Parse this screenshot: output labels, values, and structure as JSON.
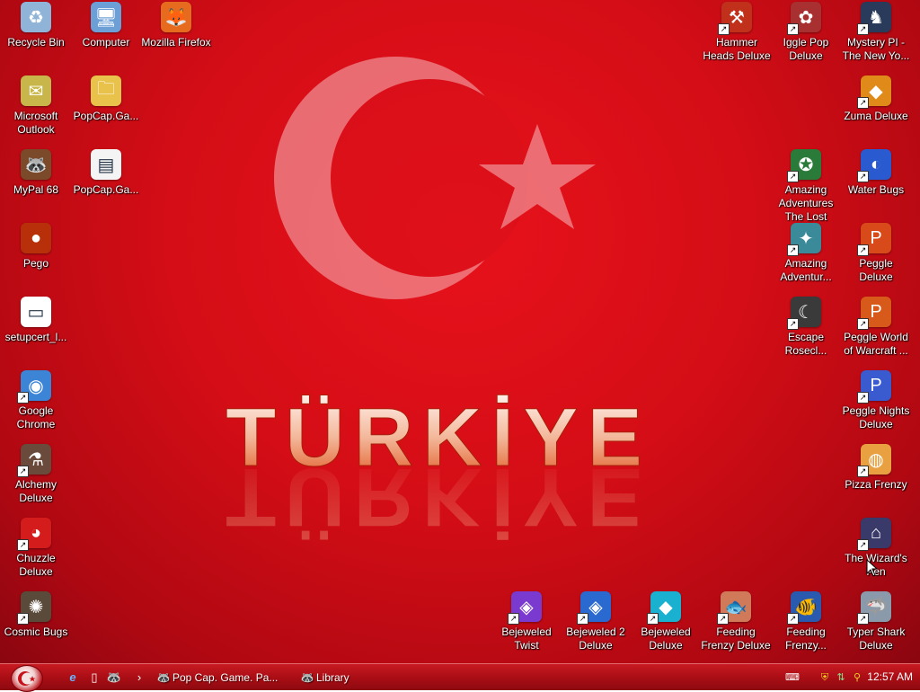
{
  "desktop": {
    "wallpaper_text": "TÜRKİYE",
    "icons": [
      {
        "id": "recycle-bin",
        "label": "Recycle Bin",
        "icon": "recycle-bin-icon",
        "color": "#8fb4d8",
        "glyph": "♻",
        "shortcut": false
      },
      {
        "id": "computer",
        "label": "Computer",
        "icon": "computer-icon",
        "color": "#6c9fd6",
        "glyph": "🖥",
        "shortcut": false
      },
      {
        "id": "mozilla-firefox",
        "label": "Mozilla Firefox",
        "icon": "firefox-icon",
        "color": "#e66b1f",
        "glyph": "🦊",
        "shortcut": false
      },
      {
        "id": "microsoft-outlook",
        "label": "Microsoft Outlook",
        "icon": "outlook-icon",
        "color": "#c9b64a",
        "glyph": "✉",
        "shortcut": false
      },
      {
        "id": "popcap-folder",
        "label": "PopCap.Ga...",
        "icon": "folder-zip-icon",
        "color": "#e8c24a",
        "glyph": "🗀",
        "shortcut": false
      },
      {
        "id": "mypal",
        "label": "MyPal 68",
        "icon": "mypal-icon",
        "color": "#7a4a2a",
        "glyph": "🦝",
        "shortcut": false
      },
      {
        "id": "popcap-file",
        "label": "PopCap.Ga...",
        "icon": "document-icon",
        "color": "#f4f4f4",
        "glyph": "▤",
        "shortcut": false
      },
      {
        "id": "pego",
        "label": "Pego",
        "icon": "pego-icon",
        "color": "#b8300a",
        "glyph": "●",
        "shortcut": false
      },
      {
        "id": "setupcert",
        "label": "setupcert_l...",
        "icon": "window-app-icon",
        "color": "#ffffff",
        "glyph": "▭",
        "shortcut": false
      },
      {
        "id": "google-chrome",
        "label": "Google Chrome",
        "icon": "chrome-icon",
        "color": "#3c84d6",
        "glyph": "◉",
        "shortcut": true
      },
      {
        "id": "alchemy",
        "label": "Alchemy Deluxe",
        "icon": "alchemy-icon",
        "color": "#6a4a3a",
        "glyph": "⚗",
        "shortcut": true
      },
      {
        "id": "chuzzle",
        "label": "Chuzzle Deluxe",
        "icon": "chuzzle-icon",
        "color": "#d41c1c",
        "glyph": "◕",
        "shortcut": true
      },
      {
        "id": "cosmic-bugs",
        "label": "Cosmic Bugs",
        "icon": "cosmic-bugs-icon",
        "color": "#5a4a3a",
        "glyph": "✺",
        "shortcut": true
      },
      {
        "id": "hammer-heads",
        "label": "Hammer Heads Deluxe",
        "icon": "hammer-heads-icon",
        "color": "#c0301a",
        "glyph": "⚒",
        "shortcut": true
      },
      {
        "id": "iggle-pop",
        "label": "Iggle Pop Deluxe",
        "icon": "iggle-pop-icon",
        "color": "#a83030",
        "glyph": "✿",
        "shortcut": true
      },
      {
        "id": "mystery-pi",
        "label": "Mystery PI - The New Yo...",
        "icon": "mystery-pi-icon",
        "color": "#2a3a5a",
        "glyph": "♞",
        "shortcut": true
      },
      {
        "id": "zuma",
        "label": "Zuma Deluxe",
        "icon": "zuma-icon",
        "color": "#e08a1a",
        "glyph": "◆",
        "shortcut": true
      },
      {
        "id": "amazing-adventures-tomb",
        "label": "Amazing Adventures The Lost Tomb",
        "icon": "amazing-adventures-icon",
        "color": "#2a7a3a",
        "glyph": "✪",
        "shortcut": true
      },
      {
        "id": "water-bugs",
        "label": "Water Bugs",
        "icon": "water-bugs-icon",
        "color": "#2a5ad0",
        "glyph": "◐",
        "shortcut": true
      },
      {
        "id": "amazing-adventures-2",
        "label": "Amazing Adventur...",
        "icon": "amazing-adventures-2-icon",
        "color": "#3a8a9a",
        "glyph": "✦",
        "shortcut": true
      },
      {
        "id": "peggle",
        "label": "Peggle Deluxe",
        "icon": "peggle-icon",
        "color": "#d84a1a",
        "glyph": "P",
        "shortcut": true
      },
      {
        "id": "escape-rosecliff",
        "label": "Escape Rosecl...",
        "icon": "escape-rosecliff-icon",
        "color": "#3a3a3a",
        "glyph": "☾",
        "shortcut": true
      },
      {
        "id": "peggle-wow",
        "label": "Peggle World of Warcraft ...",
        "icon": "peggle-wow-icon",
        "color": "#d85a1a",
        "glyph": "P",
        "shortcut": true
      },
      {
        "id": "peggle-nights",
        "label": "Peggle Nights Deluxe",
        "icon": "peggle-nights-icon",
        "color": "#3a5ad0",
        "glyph": "P",
        "shortcut": true
      },
      {
        "id": "pizza-frenzy",
        "label": "Pizza Frenzy",
        "icon": "pizza-frenzy-icon",
        "color": "#e8a040",
        "glyph": "◍",
        "shortcut": true
      },
      {
        "id": "wizards-pen",
        "label": "The Wizard's Pen",
        "icon": "wizards-pen-icon",
        "color": "#3a3a6a",
        "glyph": "⌂",
        "shortcut": true
      },
      {
        "id": "bejeweled-twist",
        "label": "Bejeweled Twist",
        "icon": "bejeweled-twist-icon",
        "color": "#7a3ad0",
        "glyph": "◈",
        "shortcut": true
      },
      {
        "id": "bejeweled-2",
        "label": "Bejeweled 2 Deluxe",
        "icon": "bejeweled-2-icon",
        "color": "#2a6ad0",
        "glyph": "◈",
        "shortcut": true
      },
      {
        "id": "bejeweled",
        "label": "Bejeweled Deluxe",
        "icon": "bejeweled-icon",
        "color": "#1ab0d0",
        "glyph": "◆",
        "shortcut": true
      },
      {
        "id": "feeding-frenzy",
        "label": "Feeding Frenzy Deluxe",
        "icon": "feeding-frenzy-icon",
        "color": "#d07a5a",
        "glyph": "🐟",
        "shortcut": true
      },
      {
        "id": "feeding-frenzy-2",
        "label": "Feeding Frenzy...",
        "icon": "feeding-frenzy-2-icon",
        "color": "#2a5ab0",
        "glyph": "🐠",
        "shortcut": true
      },
      {
        "id": "typer-shark",
        "label": "Typer Shark Deluxe",
        "icon": "typer-shark-icon",
        "color": "#8a9aaa",
        "glyph": "🦈",
        "shortcut": true
      }
    ]
  },
  "taskbar": {
    "quick_launch": [
      {
        "id": "ie",
        "icon": "internet-explorer-icon",
        "glyph": "e"
      },
      {
        "id": "desktop",
        "icon": "show-desktop-icon",
        "glyph": "▯"
      },
      {
        "id": "mypal-ql",
        "icon": "mypal-quicklaunch-icon",
        "glyph": "🦝"
      },
      {
        "id": "more",
        "icon": "chevron-right-icon",
        "glyph": "›"
      }
    ],
    "tasks": [
      {
        "id": "popcap-task",
        "label": "Pop Cap. Game. Pa...",
        "icon": "popcap-task-icon"
      },
      {
        "id": "library-task",
        "label": "Library",
        "icon": "library-task-icon"
      }
    ],
    "tray_icons": [
      "keyboard-icon",
      "shield-icon",
      "network-icon",
      "search-icon"
    ],
    "clock": "12:57 AM"
  }
}
